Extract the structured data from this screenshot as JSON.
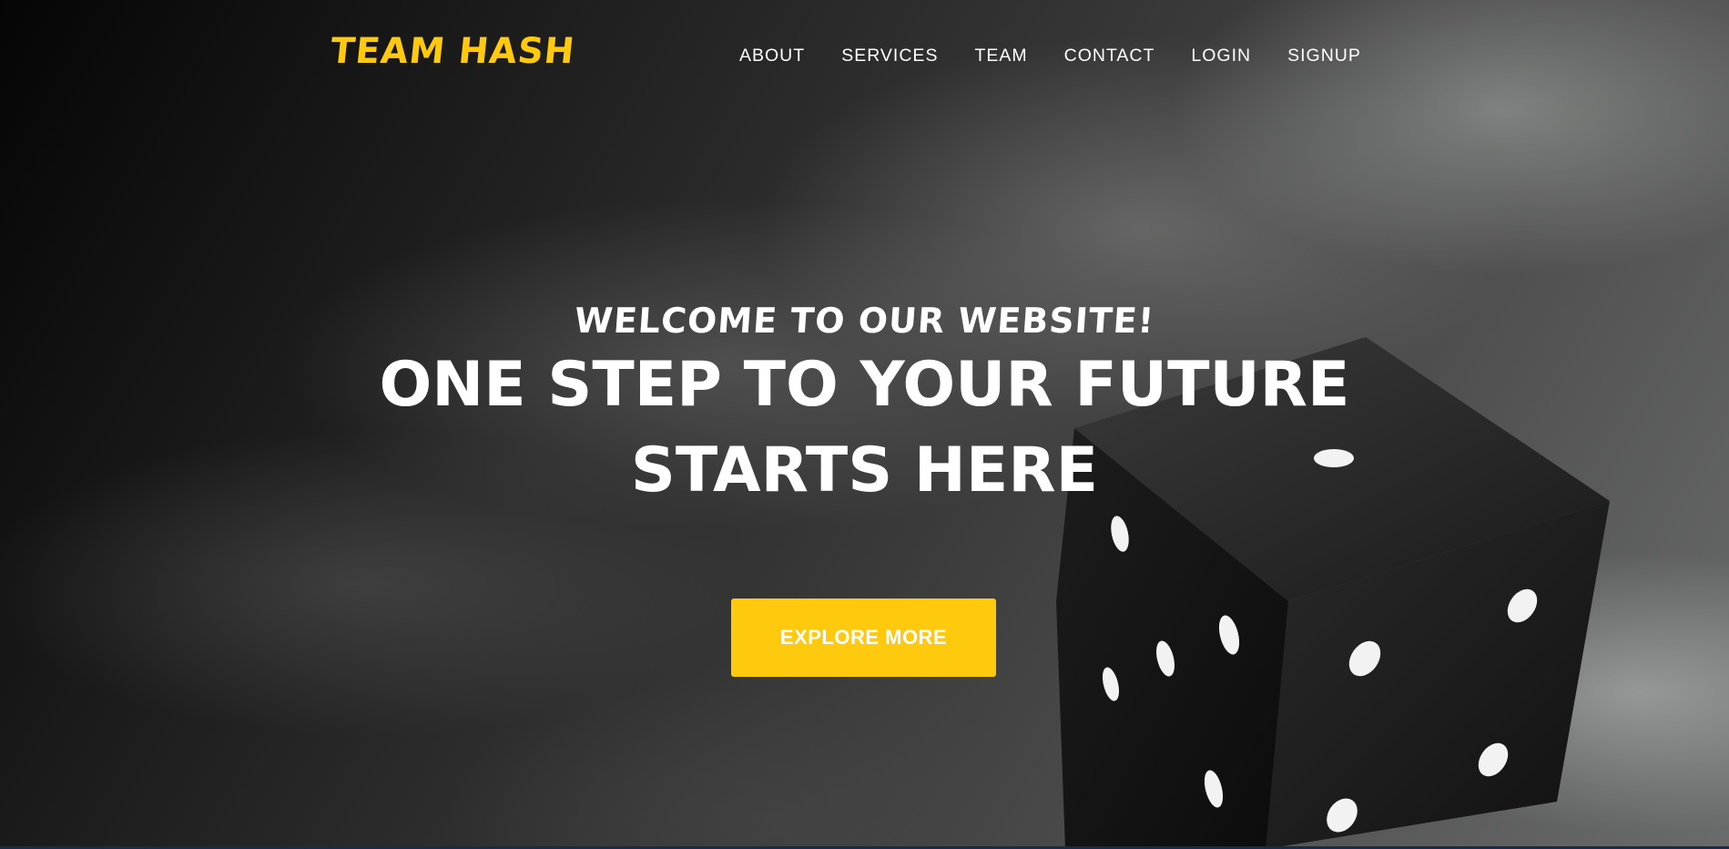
{
  "header": {
    "logo_text": "TEAM HASH",
    "nav": [
      {
        "label": "ABOUT"
      },
      {
        "label": "SERVICES"
      },
      {
        "label": "TEAM"
      },
      {
        "label": "CONTACT"
      },
      {
        "label": "LOGIN"
      },
      {
        "label": "SIGNUP"
      }
    ]
  },
  "hero": {
    "welcome": "WELCOME TO OUR WEBSITE!",
    "headline_line1": "ONE STEP TO YOUR FUTURE",
    "headline_line2": "STARTS HERE",
    "cta_label": "EXPLORE MORE",
    "background_image": "dice-on-cloudy-grey-background"
  },
  "colors": {
    "accent": "#ffc90e",
    "text": "#ffffff",
    "background": "#1a1a1a"
  }
}
